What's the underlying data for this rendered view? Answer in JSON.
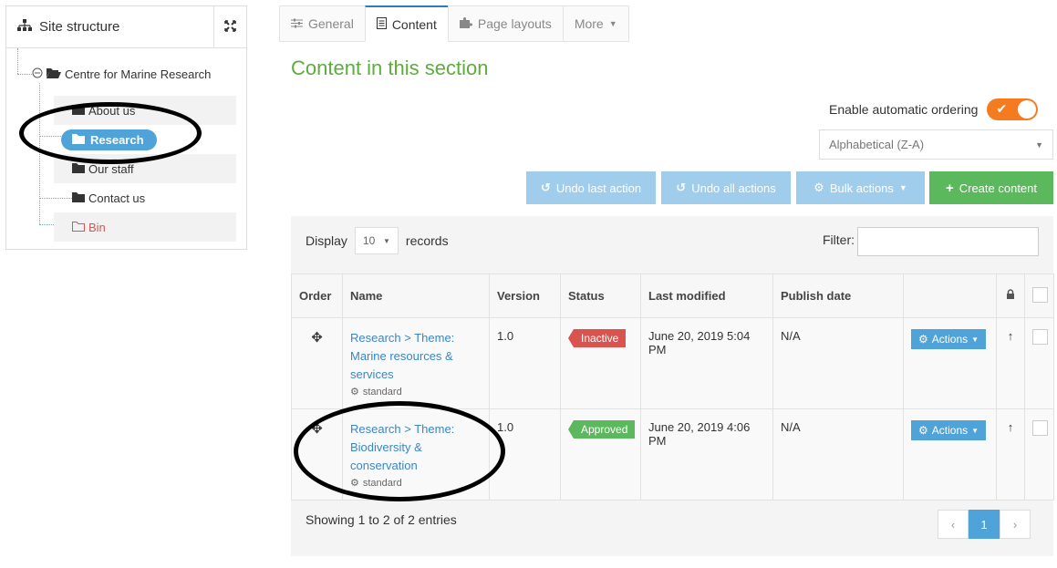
{
  "site_tree": {
    "title": "Site structure",
    "root": "Centre for Marine Research",
    "items": [
      {
        "label": "About us"
      },
      {
        "label": "Research"
      },
      {
        "label": "Our staff"
      },
      {
        "label": "Contact us"
      },
      {
        "label": "Bin"
      }
    ]
  },
  "tabs": [
    {
      "label": "General"
    },
    {
      "label": "Content"
    },
    {
      "label": "Page layouts"
    },
    {
      "label": "More"
    }
  ],
  "section_title": "Content in this section",
  "ordering": {
    "label": "Enable automatic ordering",
    "select_value": "Alphabetical (Z-A)"
  },
  "actions": {
    "undo_last": "Undo last action",
    "undo_all": "Undo all actions",
    "bulk": "Bulk actions",
    "create": "Create content"
  },
  "listing": {
    "display_label": "Display",
    "records_value": "10",
    "records_label": "records",
    "filter_label": "Filter:",
    "columns": [
      "Order",
      "Name",
      "Version",
      "Status",
      "Last modified",
      "Publish date"
    ],
    "rows": [
      {
        "name": "Research > Theme: Marine resources & services",
        "type": "standard",
        "version": "1.0",
        "status": "Inactive",
        "last_modified": "June 20, 2019 5:04 PM",
        "publish_date": "N/A",
        "actions_label": "Actions"
      },
      {
        "name": "Research > Theme: Biodiversity & conservation",
        "type": "standard",
        "version": "1.0",
        "status": "Approved",
        "last_modified": "June 20, 2019 4:06 PM",
        "publish_date": "N/A",
        "actions_label": "Actions"
      }
    ],
    "footer": "Showing 1 to 2 of 2 entries",
    "pagination": {
      "prev": "‹",
      "current": "1",
      "next": "›"
    }
  },
  "colors": {
    "title_green": "#5cad3e",
    "accent_blue": "#4fa3d9",
    "toggle_orange": "#f47b20",
    "inactive_red": "#d9534f",
    "approved_green": "#5cb85c"
  }
}
